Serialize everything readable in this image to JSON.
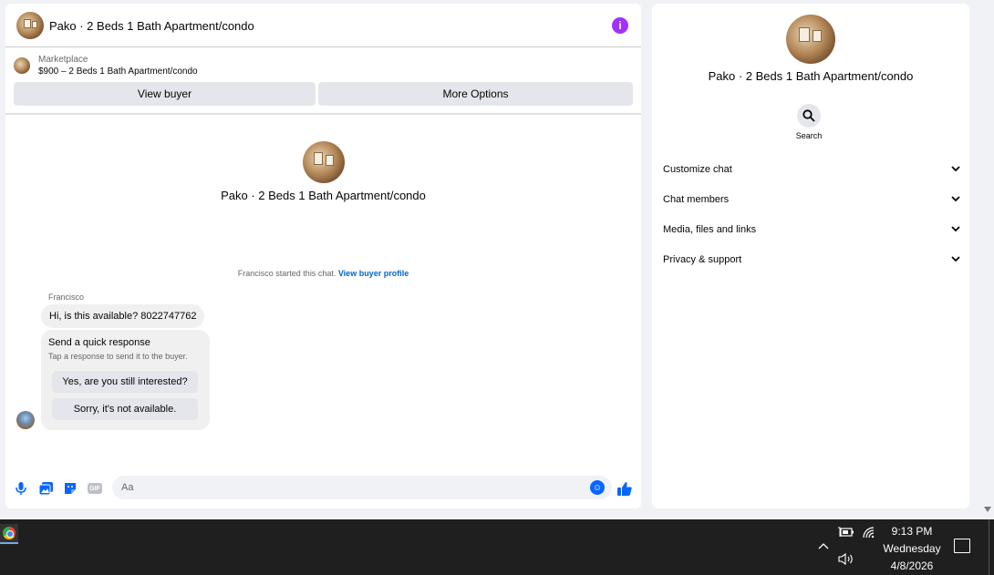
{
  "chat": {
    "header_title": "Pako · 2 Beds 1 Bath Apartment/condo",
    "listing_label": "Marketplace",
    "listing_price": "$900 – 2 Beds 1 Bath Apartment/condo",
    "view_buyer_label": "View buyer",
    "more_options_label": "More Options",
    "center_title": "Pako · 2 Beds 1 Bath Apartment/condo",
    "started_text": "Francisco started this chat.",
    "view_buyer_profile": "View buyer profile",
    "sender_name": "Francisco",
    "message": "Hi, is this available? 8022747762",
    "quick_title": "Send a quick response",
    "quick_sub": "Tap a response to send it to the buyer.",
    "quick_options": [
      "Yes, are you still interested?",
      "Sorry, it's not available."
    ],
    "input_placeholder": "Aa",
    "composer_icons": [
      "mic-icon",
      "photo-icon",
      "sticker-icon",
      "gif-icon",
      "emoji-icon",
      "like-icon"
    ],
    "gif_label": "GIF"
  },
  "side": {
    "title": "Pako · 2 Beds 1 Bath Apartment/condo",
    "search_label": "Search",
    "sections": [
      "Customize chat",
      "Chat members",
      "Media, files and links",
      "Privacy & support"
    ]
  },
  "taskbar": {
    "time": "9:13 PM",
    "day": "Wednesday",
    "date": "4/8/2026"
  },
  "colors": {
    "accent": "#0866ff",
    "info": "#a033ff",
    "link": "#0064d1",
    "taskbar": "#1f1f1f"
  }
}
